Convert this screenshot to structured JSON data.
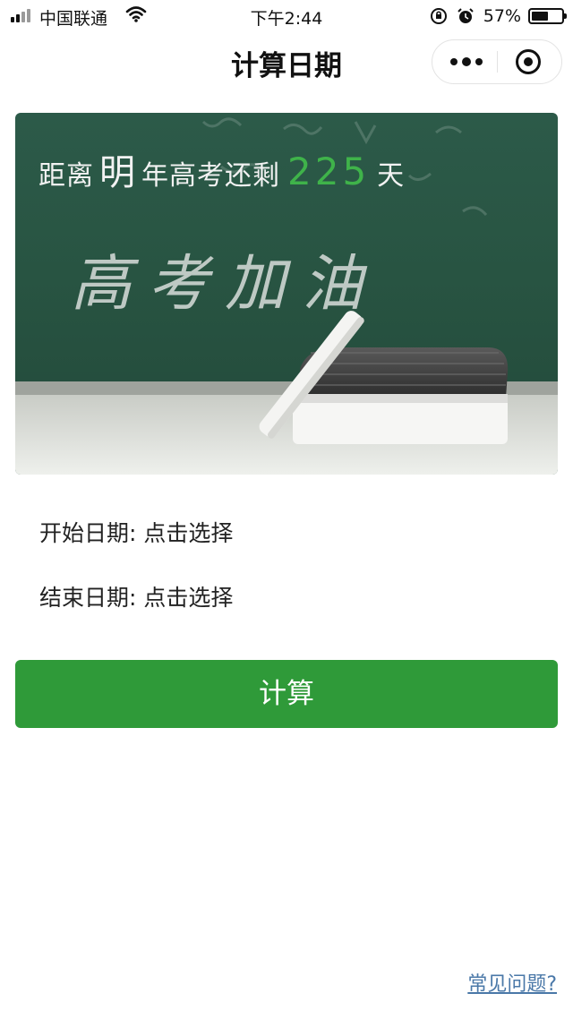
{
  "status_bar": {
    "carrier": "中国联通",
    "time": "下午2:44",
    "battery_percent": "57%",
    "battery_level": 0.57,
    "icons": [
      "signal-icon",
      "wifi-icon",
      "orientation-lock-icon",
      "alarm-icon",
      "battery-icon"
    ]
  },
  "nav": {
    "title": "计算日期",
    "more_icon": "more-dots-icon",
    "close_icon": "target-circle-icon"
  },
  "banner": {
    "prefix": "距离",
    "highlight": "明",
    "middle": "年高考还剩",
    "days": "225",
    "suffix": "天",
    "chalk_text": "高考加油",
    "days_color": "#3fb34a"
  },
  "form": {
    "start_label": "开始日期: 点击选择",
    "end_label": "结束日期: 点击选择"
  },
  "calc_button": {
    "label": "计算",
    "color": "#2f9a39"
  },
  "footer": {
    "faq_link": "常见问题?",
    "link_color": "#4a78a8"
  }
}
